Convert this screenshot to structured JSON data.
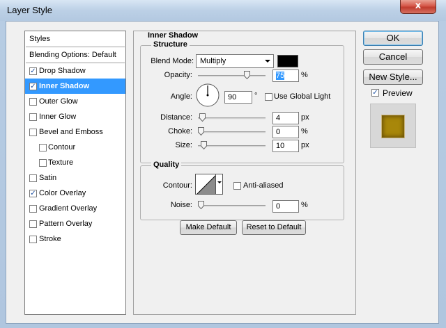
{
  "window": {
    "title": "Layer Style",
    "close_label": "x"
  },
  "styles_list": {
    "header": "Styles",
    "blending": "Blending Options: Default",
    "items": [
      {
        "label": "Drop Shadow",
        "checked": true
      },
      {
        "label": "Inner Shadow",
        "checked": true,
        "selected": true
      },
      {
        "label": "Outer Glow",
        "checked": false
      },
      {
        "label": "Inner Glow",
        "checked": false
      },
      {
        "label": "Bevel and Emboss",
        "checked": false
      },
      {
        "label": "Contour",
        "checked": false,
        "sub": true
      },
      {
        "label": "Texture",
        "checked": false,
        "sub": true
      },
      {
        "label": "Satin",
        "checked": false
      },
      {
        "label": "Color Overlay",
        "checked": true
      },
      {
        "label": "Gradient Overlay",
        "checked": false
      },
      {
        "label": "Pattern Overlay",
        "checked": false
      },
      {
        "label": "Stroke",
        "checked": false
      }
    ]
  },
  "panel": {
    "title": "Inner Shadow",
    "structure": {
      "title": "Structure",
      "blend_mode_label": "Blend Mode:",
      "blend_mode_value": "Multiply",
      "shadow_color": "#000000",
      "opacity_label": "Opacity:",
      "opacity_value": "75",
      "opacity_unit": "%",
      "opacity_fraction": 0.75,
      "angle_label": "Angle:",
      "angle_value": "90",
      "angle_unit": "°",
      "global_light_label": "Use Global Light",
      "global_light_checked": false,
      "distance_label": "Distance:",
      "distance_value": "4",
      "distance_unit": "px",
      "distance_fraction": 0.02,
      "choke_label": "Choke:",
      "choke_value": "0",
      "choke_unit": "%",
      "choke_fraction": 0,
      "size_label": "Size:",
      "size_value": "10",
      "size_unit": "px",
      "size_fraction": 0.04
    },
    "quality": {
      "title": "Quality",
      "contour_label": "Contour:",
      "anti_aliased_label": "Anti-aliased",
      "anti_aliased_checked": false,
      "noise_label": "Noise:",
      "noise_value": "0",
      "noise_unit": "%",
      "noise_fraction": 0
    },
    "make_default_label": "Make Default",
    "reset_default_label": "Reset to Default"
  },
  "actions": {
    "ok_label": "OK",
    "cancel_label": "Cancel",
    "new_style_label": "New Style...",
    "preview_label": "Preview",
    "preview_checked": true,
    "preview_color": "#a8870a"
  },
  "colors": {
    "selection": "#3399ff",
    "check": "#1a4ea0"
  }
}
